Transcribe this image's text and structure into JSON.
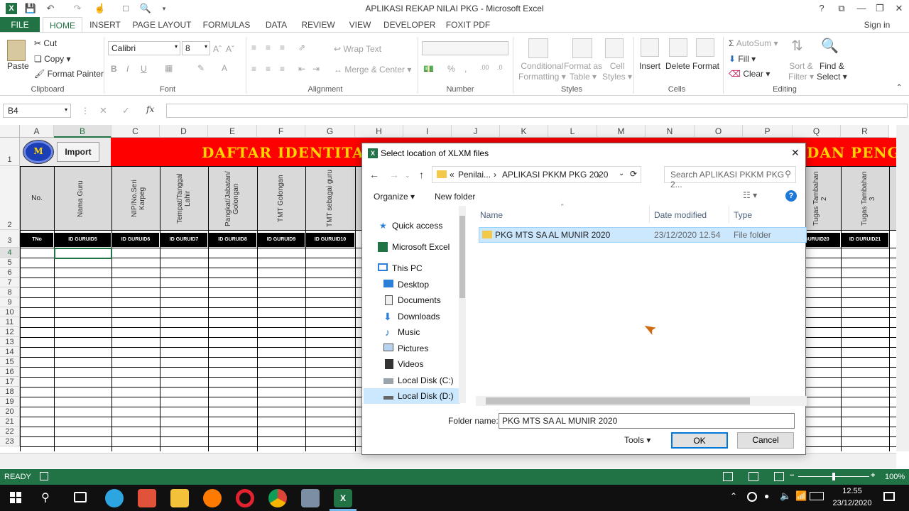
{
  "window": {
    "title": "APLIKASI REKAP NILAI PKG - Microsoft Excel",
    "sign_in": "Sign in"
  },
  "ribbon_tabs": [
    "FILE",
    "HOME",
    "INSERT",
    "PAGE LAYOUT",
    "FORMULAS",
    "DATA",
    "REVIEW",
    "VIEW",
    "DEVELOPER",
    "FOXIT PDF"
  ],
  "ribbon": {
    "clipboard": {
      "paste": "Paste",
      "cut": "Cut",
      "copy": "Copy",
      "format_painter": "Format Painter",
      "label": "Clipboard"
    },
    "font": {
      "name": "Calibri",
      "size": "8",
      "label": "Font"
    },
    "alignment": {
      "wrap": "Wrap Text",
      "merge": "Merge & Center",
      "label": "Alignment"
    },
    "number": {
      "label": "Number"
    },
    "styles": {
      "conditional": "Conditional",
      "formatting": "Formatting",
      "format_as": "Format as",
      "table": "Table",
      "cell": "Cell",
      "cell_styles": "Styles",
      "label": "Styles"
    },
    "cells": {
      "insert": "Insert",
      "delete": "Delete",
      "format": "Format",
      "label": "Cells"
    },
    "editing": {
      "autosum": "AutoSum",
      "fill": "Fill",
      "clear": "Clear",
      "sort": "Sort &",
      "filter": "Filter",
      "find": "Find &",
      "select": "Select",
      "label": "Editing"
    }
  },
  "formula_bar": {
    "name_box": "B4",
    "fx": "fx",
    "content": ""
  },
  "sheet": {
    "columns": [
      "A",
      "B",
      "C",
      "D",
      "E",
      "F",
      "G",
      "H",
      "I",
      "J",
      "K",
      "L",
      "M",
      "N",
      "O",
      "P",
      "Q",
      "R"
    ],
    "rows": [
      "1",
      "2",
      "3",
      "4",
      "5",
      "6",
      "7",
      "8",
      "9",
      "10",
      "11",
      "12",
      "13",
      "14",
      "15",
      "16",
      "17",
      "18",
      "19",
      "20",
      "21",
      "22",
      "23"
    ],
    "logo_letter": "M",
    "import_button": "Import",
    "banner_left": "DAFTAR IDENTITA",
    "banner_right": "DAN PENG",
    "headers": {
      "no": "No.",
      "nama": "Nama Guru",
      "nip": "NIP/No.Seri Karpeg",
      "ttl": "Tempat/Tanggal Lahir",
      "pangkat": "Pangkat/Jabatan/ Golongan",
      "tmt_gol": "TMT Golongan",
      "tmt_guru": "TMT sebagai guru",
      "tugas2": "Tugas Tambahan 2",
      "tugas3": "Tugas Tambahan 3"
    },
    "ids": {
      "a": "TNo",
      "b": "ID GURUID5",
      "c": "ID GURUID6",
      "d": "ID GURUID7",
      "e": "ID GURUID8",
      "f": "ID GURUID9",
      "g": "ID GURUID10",
      "q": "GURUID20",
      "r": "ID GURUID21"
    }
  },
  "dialog": {
    "title": "Select location of XLXM files",
    "breadcrumb": [
      "«",
      "Penilai...",
      "›",
      "APLIKASI PKKM PKG 2020",
      "›"
    ],
    "search_placeholder": "Search APLIKASI PKKM PKG 2...",
    "organize": "Organize",
    "new_folder": "New folder",
    "nav": [
      "Quick access",
      "Microsoft Excel",
      "This PC",
      "Desktop",
      "Documents",
      "Downloads",
      "Music",
      "Pictures",
      "Videos",
      "Local Disk (C:)",
      "Local Disk (D:)"
    ],
    "columns": {
      "name": "Name",
      "date": "Date modified",
      "type": "Type"
    },
    "file": {
      "name": "PKG MTS SA AL MUNIR 2020",
      "date": "23/12/2020 12.54",
      "type": "File folder"
    },
    "folder_name_label": "Folder name:",
    "folder_name_value": "PKG MTS SA AL MUNIR 2020",
    "tools": "Tools",
    "ok": "OK",
    "cancel": "Cancel"
  },
  "status": {
    "ready": "READY",
    "zoom": "100%"
  },
  "taskbar": {
    "time": "12.55",
    "date": "23/12/2020"
  }
}
